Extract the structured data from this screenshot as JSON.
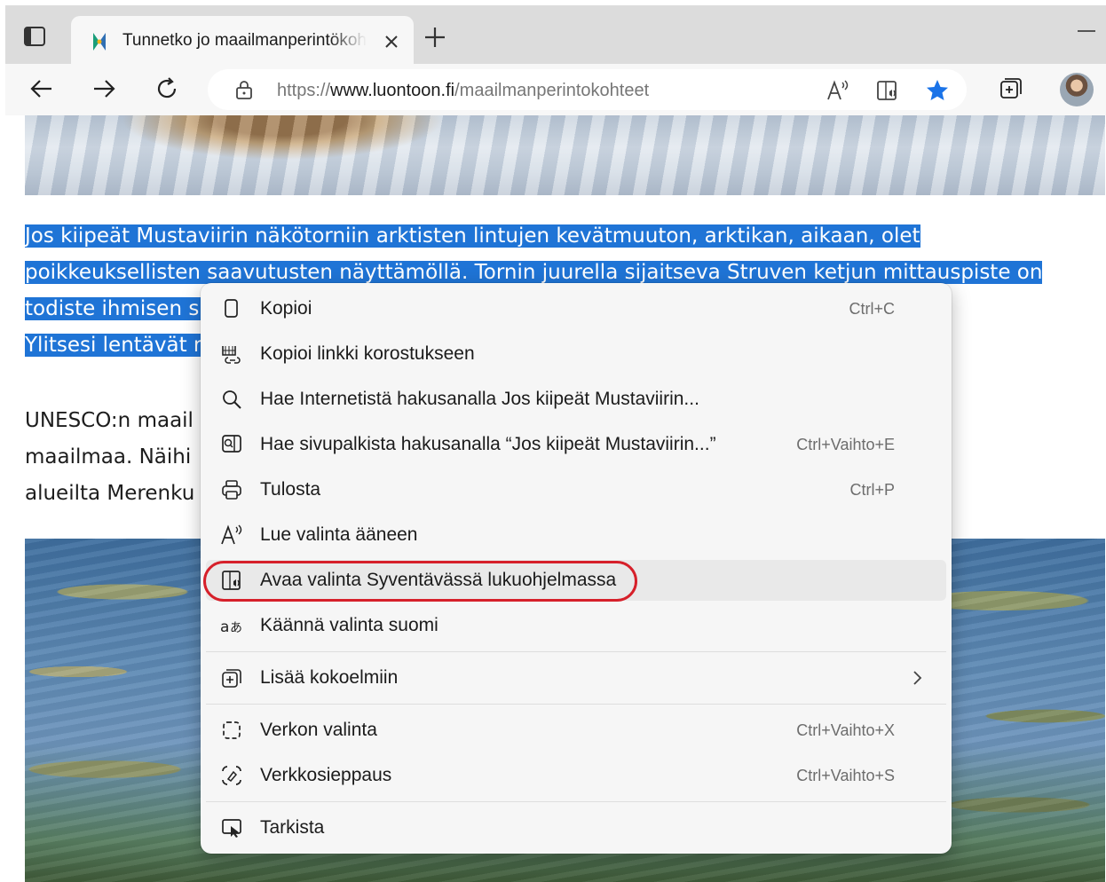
{
  "tab": {
    "title": "Tunnetko jo maailmanperintökohteet"
  },
  "address": {
    "scheme": "https://",
    "host": "www.luontoon.fi",
    "path": "/maailmanperintokohteet"
  },
  "article": {
    "selected_lines": [
      "Jos kiipeät Mustaviirin näkötorniin arktisten lintujen kevätmuuton, arktikan, aikaan, olet",
      "poikkeuksellisten saavutusten näyttämöllä. Tornin juurella sijaitseva Struven ketjun mittauspiste on",
      "todiste ihmisen s                                                                                         en keinoin.",
      "Ylitsesi lentävät r                                                                                                        a."
    ],
    "normal_lines": [
      "UNESCO:n maail                                                                                             oston ympäri",
      "maailmaa. Näihi                                                                                             llituksen",
      "alueilta Merenku                                                                                             ä."
    ]
  },
  "context_menu": {
    "items": [
      {
        "icon": "copy-icon",
        "label": "Kopioi",
        "shortcut": "Ctrl+C"
      },
      {
        "icon": "copy-link-icon",
        "label": "Kopioi linkki korostukseen",
        "shortcut": ""
      },
      {
        "icon": "search-icon",
        "label": "Hae Internetistä hakusanalla Jos kiipeät Mustaviirin...",
        "shortcut": ""
      },
      {
        "icon": "sidebar-search-icon",
        "label": "Hae sivupalkista hakusanalla “Jos kiipeät Mustaviirin...”",
        "shortcut": "Ctrl+Vaihto+E"
      },
      {
        "icon": "print-icon",
        "label": "Tulosta",
        "shortcut": "Ctrl+P"
      },
      {
        "icon": "read-aloud-icon",
        "label": "Lue valinta ääneen",
        "shortcut": ""
      },
      {
        "icon": "immersive-reader-icon",
        "label": "Avaa valinta Syventävässä lukuohjelmassa",
        "shortcut": ""
      },
      {
        "icon": "translate-icon",
        "label": "Käännä valinta suomi",
        "shortcut": ""
      },
      {
        "icon": "collections-icon",
        "label": "Lisää kokoelmiin",
        "shortcut": ""
      },
      {
        "icon": "web-select-icon",
        "label": "Verkon valinta",
        "shortcut": "Ctrl+Vaihto+X"
      },
      {
        "icon": "web-capture-icon",
        "label": "Verkkosieppaus",
        "shortcut": "Ctrl+Vaihto+S"
      },
      {
        "icon": "inspect-icon",
        "label": "Tarkista",
        "shortcut": ""
      }
    ],
    "highlighted_item": "Avaa valinta Syventävässä lukuohjelmassa"
  },
  "colors": {
    "selection": "#1f74d6",
    "favorite_star": "#1a73e8",
    "annotation_ring": "#d6202a"
  }
}
